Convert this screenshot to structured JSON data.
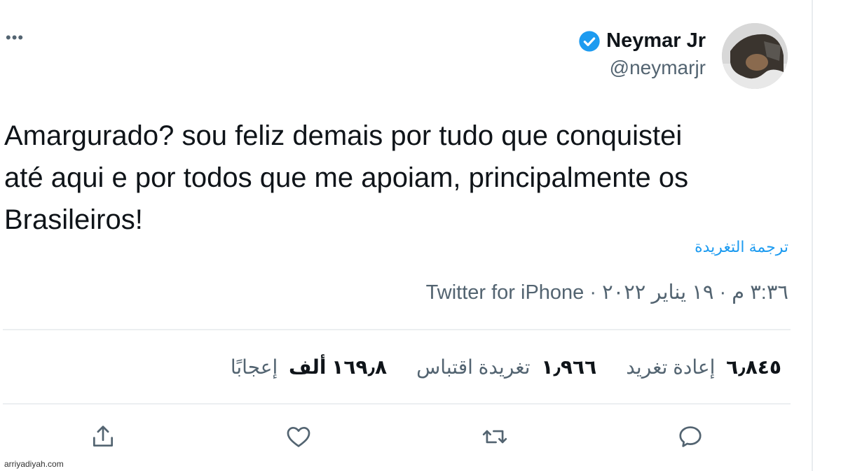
{
  "author": {
    "name": "Neymar Jr",
    "handle": "@neymarjr",
    "verified": true
  },
  "tweet": {
    "text_lines": [
      "Amargurado? sou feliz demais por tudo que conquistei",
      "até aqui e por todos que me apoiam, principalmente os",
      "Brasileiros!"
    ],
    "translate_label": "ترجمة التغريدة",
    "timestamp": "٣:٣٦ م · ١٩ يناير ٢٠٢٢ · ",
    "source": "Twitter for iPhone"
  },
  "stats": {
    "retweets": {
      "count": "٦٫٨٤٥",
      "label": "إعادة تغريد"
    },
    "quotes": {
      "count": "١٫٩٦٦",
      "label": "تغريدة اقتباس"
    },
    "likes": {
      "count": "١٦٩٫٨ ألف",
      "label": "إعجابًا"
    }
  },
  "actions": {
    "reply_icon": "reply-icon",
    "retweet_icon": "retweet-icon",
    "like_icon": "like-icon",
    "share_icon": "share-icon"
  },
  "more_icon": "more-icon",
  "watermark": "arriyadiyah.com",
  "colors": {
    "verified_blue": "#1d9bf0",
    "link_blue": "#1d9bf0",
    "secondary_text": "#536471"
  }
}
